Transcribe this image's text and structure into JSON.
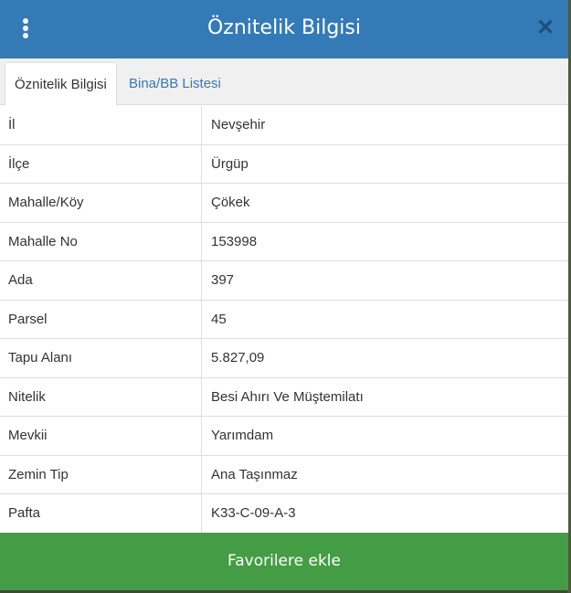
{
  "header": {
    "title": "Öznitelik Bilgisi",
    "menu_icon": "kebab-vertical-icon",
    "close_icon": "close-icon",
    "close_glyph": "✕"
  },
  "tabs": [
    {
      "label": "Öznitelik Bilgisi",
      "active": true
    },
    {
      "label": "Bina/BB Listesi",
      "active": false
    }
  ],
  "rows": [
    {
      "key": "İl",
      "value": "Nevşehir"
    },
    {
      "key": "İlçe",
      "value": "Ürgüp"
    },
    {
      "key": "Mahalle/Köy",
      "value": "Çökek"
    },
    {
      "key": "Mahalle No",
      "value": "153998"
    },
    {
      "key": "Ada",
      "value": "397"
    },
    {
      "key": "Parsel",
      "value": "45"
    },
    {
      "key": "Tapu Alanı",
      "value": "5.827,09"
    },
    {
      "key": "Nitelik",
      "value": "Besi Ahırı Ve Müştemilatı"
    },
    {
      "key": "Mevkii",
      "value": "Yarımdam"
    },
    {
      "key": "Zemin Tip",
      "value": "Ana Taşınmaz"
    },
    {
      "key": "Pafta",
      "value": "K33-C-09-A-3"
    }
  ],
  "footer": {
    "button_label": "Favorilere ekle"
  },
  "colors": {
    "header": "#337ab7",
    "footer": "#449d44",
    "tab_link": "#337ab7"
  }
}
